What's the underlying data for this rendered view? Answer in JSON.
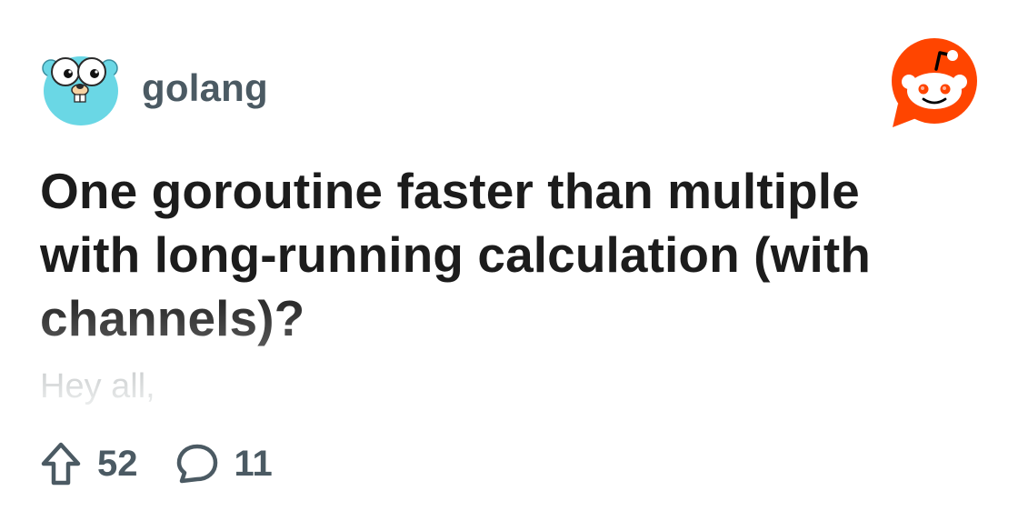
{
  "subreddit": {
    "name": "golang",
    "avatar_icon": "gopher-avatar-icon"
  },
  "brand": {
    "logo_icon": "reddit-snoo-logo-icon",
    "color": "#ff4500"
  },
  "post": {
    "title": "One goroutine faster than multiple with long-running calculation (with channels)?",
    "body_preview": "Hey all,"
  },
  "stats": {
    "upvotes": "52",
    "comments": "11",
    "upvote_icon": "upvote-arrow-icon",
    "comment_icon": "comment-bubble-icon"
  }
}
